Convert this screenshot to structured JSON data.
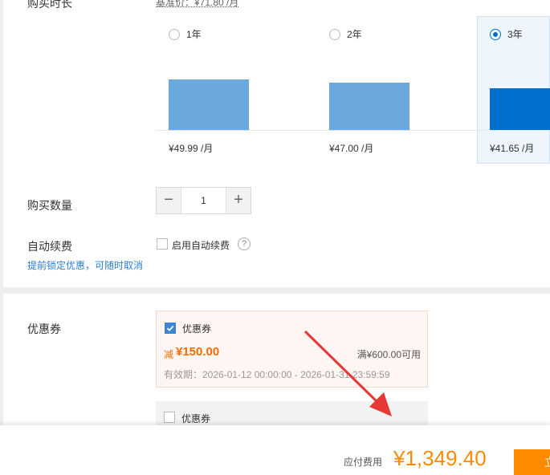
{
  "duration": {
    "label": "购买时长",
    "base_price": "基准价：¥71.80 /月",
    "options": [
      {
        "label": "1年",
        "price": "¥49.99 /月",
        "selected": false,
        "bar_fraction": 0.63
      },
      {
        "label": "2年",
        "price": "¥47.00 /月",
        "selected": false,
        "bar_fraction": 0.59
      },
      {
        "label": "3年",
        "price": "¥41.65 /月",
        "selected": true,
        "bar_fraction": 0.52
      }
    ]
  },
  "quantity": {
    "label": "购买数量",
    "value": "1",
    "minus": "−",
    "plus": "+"
  },
  "auto_renew": {
    "label": "自动续费",
    "checkbox_label": "启用自动续费",
    "help": "?",
    "hint": "提前锁定优惠，可随时取消"
  },
  "coupon": {
    "label": "优惠券",
    "items": [
      {
        "title": "优惠券",
        "checked": true,
        "discount_prefix": "减",
        "discount": "¥150.00",
        "condition": "满¥600.00可用",
        "validity": "有效期：2026-01-12 00:00:00 - 2026-01-31 23:59:59"
      },
      {
        "title": "优惠券",
        "checked": false
      }
    ]
  },
  "footer": {
    "total_label": "应付费用",
    "total": "¥1,349.40",
    "submit": "立"
  },
  "colors": {
    "accent": "#0070cc",
    "price": "#ff8a00",
    "discount": "#ff6a00"
  }
}
